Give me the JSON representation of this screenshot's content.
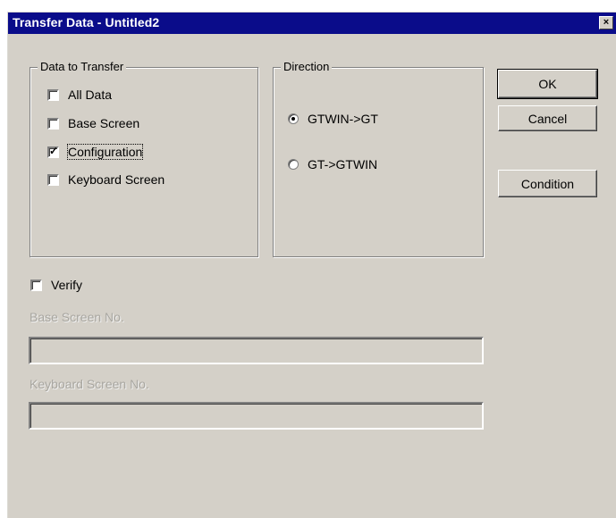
{
  "window": {
    "title": "Transfer Data - Untitled2",
    "close_glyph": "×"
  },
  "data_to_transfer": {
    "label": "Data to Transfer",
    "items": [
      {
        "label": "All Data",
        "checked": false
      },
      {
        "label": "Base Screen",
        "checked": false
      },
      {
        "label": "Configuration",
        "checked": true
      },
      {
        "label": "Keyboard Screen",
        "checked": false
      }
    ]
  },
  "direction": {
    "label": "Direction",
    "options": [
      {
        "label": "GTWIN->GT",
        "selected": true
      },
      {
        "label": "GT->GTWIN",
        "selected": false
      }
    ]
  },
  "buttons": {
    "ok": "OK",
    "cancel": "Cancel",
    "condition": "Condition"
  },
  "verify": {
    "label": "Verify",
    "checked": false
  },
  "base_screen_no": {
    "label": "Base Screen No.",
    "value": ""
  },
  "keyboard_screen_no": {
    "label": "Keyboard Screen No.",
    "value": ""
  },
  "check_glyph": "✓"
}
